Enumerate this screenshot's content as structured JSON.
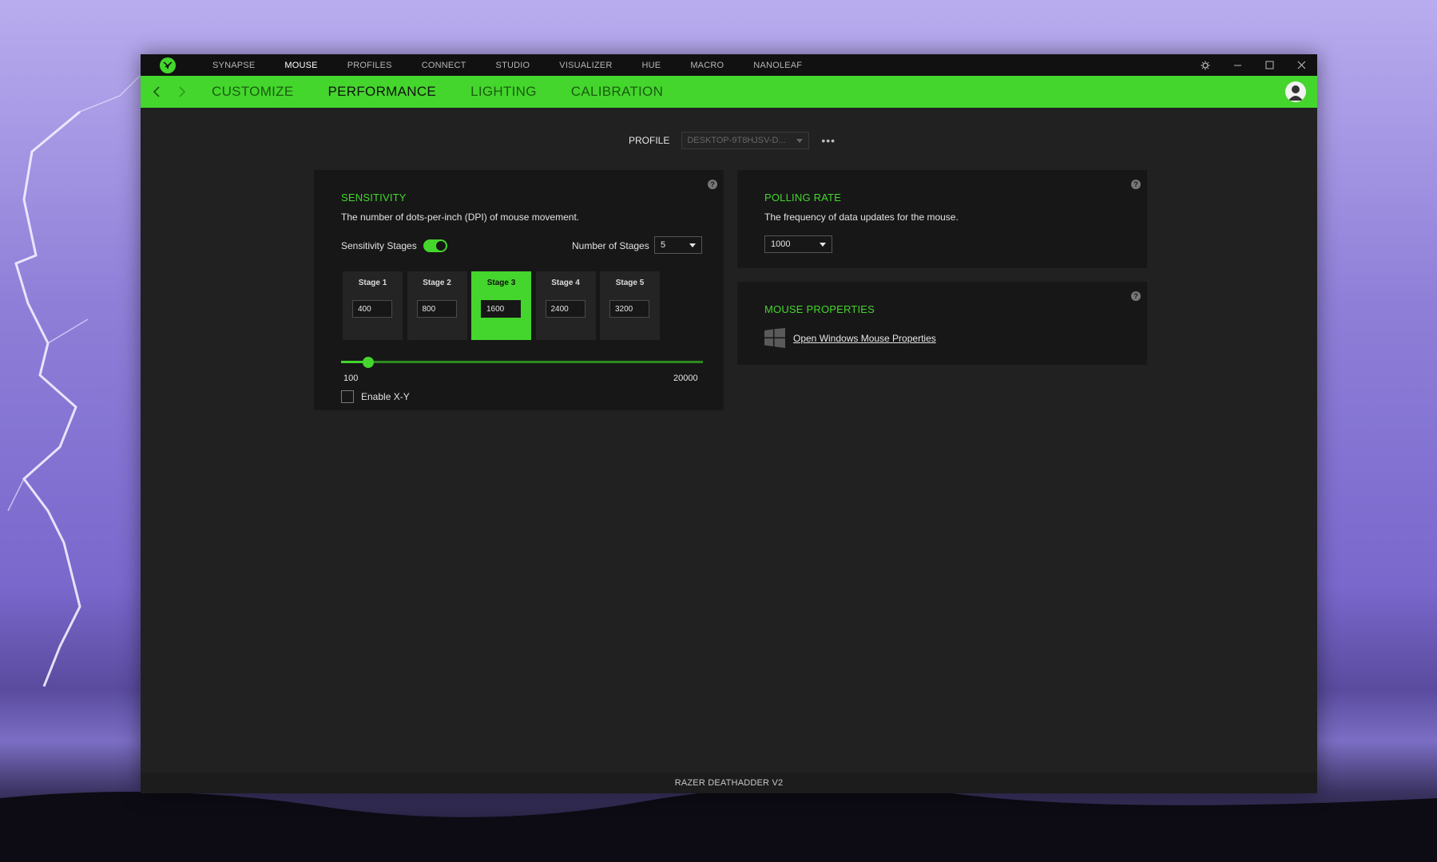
{
  "window": {
    "topnav": [
      "SYNAPSE",
      "MOUSE",
      "PROFILES",
      "CONNECT",
      "STUDIO",
      "VISUALIZER",
      "HUE",
      "MACRO",
      "NANOLEAF"
    ],
    "active_topnav": "MOUSE",
    "subnav": [
      "CUSTOMIZE",
      "PERFORMANCE",
      "LIGHTING",
      "CALIBRATION"
    ],
    "active_subnav": "PERFORMANCE"
  },
  "profile": {
    "label": "PROFILE",
    "value": "DESKTOP-9T8HJSV-D...",
    "more": "•••"
  },
  "sensitivity": {
    "title": "SENSITIVITY",
    "description": "The number of dots-per-inch (DPI) of mouse movement.",
    "stages_label": "Sensitivity Stages",
    "stages_enabled": true,
    "num_stages_label": "Number of Stages",
    "num_stages_value": "5",
    "stages": [
      {
        "label": "Stage 1",
        "value": "400"
      },
      {
        "label": "Stage 2",
        "value": "800"
      },
      {
        "label": "Stage 3",
        "value": "1600"
      },
      {
        "label": "Stage 4",
        "value": "2400"
      },
      {
        "label": "Stage 5",
        "value": "3200"
      }
    ],
    "active_stage": 2,
    "slider_min": "100",
    "slider_max": "20000",
    "slider_value": 1600,
    "enable_xy_label": "Enable X-Y",
    "enable_xy_checked": false
  },
  "polling": {
    "title": "POLLING RATE",
    "description": "The frequency of data updates for the mouse.",
    "value": "1000"
  },
  "mouse_properties": {
    "title": "MOUSE PROPERTIES",
    "link": "Open Windows Mouse Properties"
  },
  "help_glyph": "?",
  "status": {
    "device": "RAZER DEATHADDER V2"
  },
  "colors": {
    "accent": "#44d62c",
    "window_bg": "#212121",
    "card_bg": "#171717"
  }
}
